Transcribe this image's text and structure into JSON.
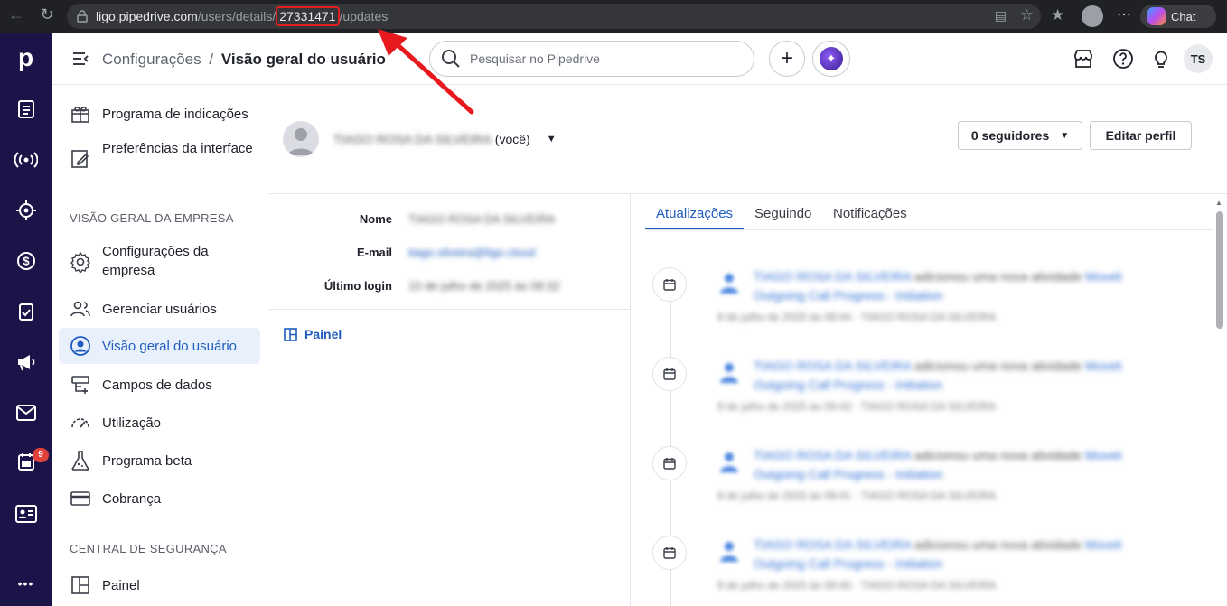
{
  "browser": {
    "url_host": "ligo.pipedrive.com",
    "url_path_before": "/users/details/",
    "url_highlight": "27331471",
    "url_path_after": "/updates",
    "chat_label": "Chat"
  },
  "leftnav": {
    "badge_count": "9",
    "more_label": "•••"
  },
  "topbar": {
    "breadcrumb_parent": "Configurações",
    "breadcrumb_sep": "/",
    "breadcrumb_current": "Visão geral do usuário",
    "search_placeholder": "Pesquisar no Pipedrive",
    "avatar_initials": "TS"
  },
  "sidebar": {
    "items_top": [
      {
        "label": "Programa de indicações"
      },
      {
        "label": "Preferências da interface"
      }
    ],
    "section_company": "VISÃO GERAL DA EMPRESA",
    "items_company": [
      {
        "label": "Configurações da empresa"
      },
      {
        "label": "Gerenciar usuários"
      },
      {
        "label": "Visão geral do usuário"
      },
      {
        "label": "Campos de dados"
      },
      {
        "label": "Utilização"
      },
      {
        "label": "Programa beta"
      },
      {
        "label": "Cobrança"
      }
    ],
    "section_security": "CENTRAL DE SEGURANÇA",
    "items_security": [
      {
        "label": "Painel"
      }
    ]
  },
  "profile": {
    "name": "TIAGO ROSA DA SILVEIRA",
    "you_label": "(você)",
    "followers_label": "0 seguidores",
    "edit_label": "Editar perfil",
    "fields": {
      "name_label": "Nome",
      "name_value": "TIAGO ROSA DA SILVEIRA",
      "email_label": "E-mail",
      "email_value": "tiago.silveira@ligo.cloud",
      "login_label": "Último login",
      "login_value": "10 de julho de 2025 às 08:32"
    },
    "panel_link": "Painel"
  },
  "tabs": {
    "updates": "Atualizações",
    "following": "Seguindo",
    "notifications": "Notificações"
  },
  "feed": [
    {
      "actor": "TIAGO ROSA DA SILVEIRA",
      "action": " adicionou uma nova atividade ",
      "link": "Moveli Outgoing Call Progress - Initiation",
      "meta": "8 de julho de 2025 às 09:44 · TIAGO ROSA DA SILVEIRA"
    },
    {
      "actor": "TIAGO ROSA DA SILVEIRA",
      "action": " adicionou uma nova atividade ",
      "link": "Moveli Outgoing Call Progress - Initiation",
      "meta": "8 de julho de 2025 às 09:43 · TIAGO ROSA DA SILVEIRA"
    },
    {
      "actor": "TIAGO ROSA DA SILVEIRA",
      "action": " adicionou uma nova atividade ",
      "link": "Moveli Outgoing Call Progress - Initiation",
      "meta": "8 de julho de 2025 às 09:41 · TIAGO ROSA DA SILVEIRA"
    },
    {
      "actor": "TIAGO ROSA DA SILVEIRA",
      "action": " adicionou uma nova atividade ",
      "link": "Moveli Outgoing Call Progress - Initiation",
      "meta": "8 de julho de 2025 às 09:40 · TIAGO ROSA DA SILVEIRA"
    }
  ]
}
